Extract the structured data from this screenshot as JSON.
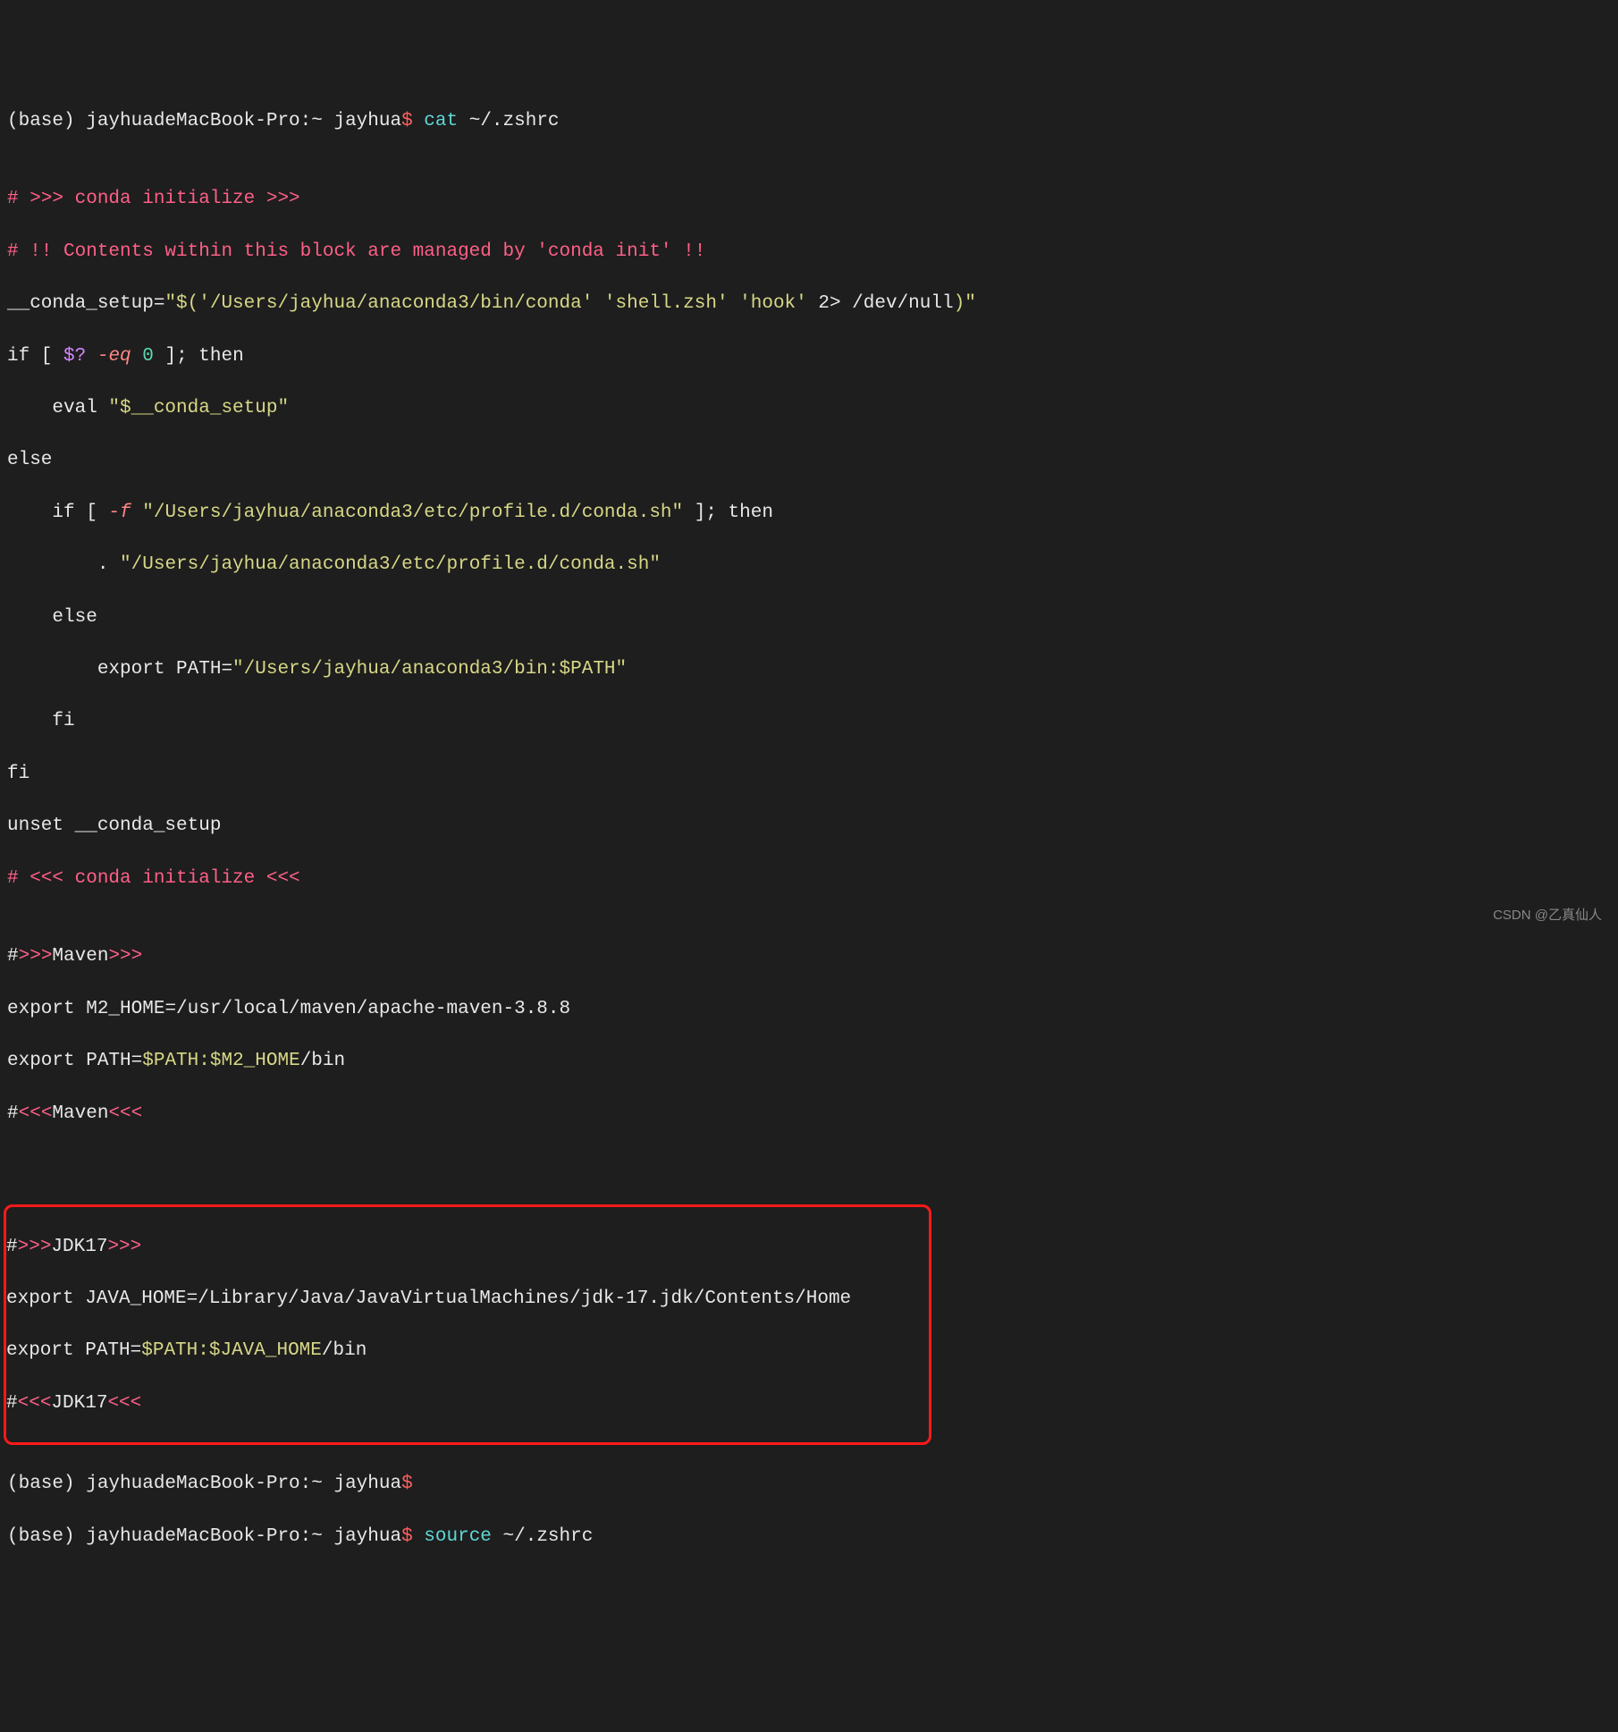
{
  "prompt1": {
    "env": "(base) ",
    "host": "jayhuadeMacBook-Pro:~ jayhua",
    "dollar": "$ ",
    "cmd": "cat ",
    "arg": "~/.zshrc"
  },
  "blank1": "",
  "l_comment1": "# >>> conda initialize >>>",
  "l_comment2": "# !! Contents within this block are managed by 'conda init' !!",
  "l_setup": {
    "a": "__conda_setup=",
    "b": "\"$(",
    "c": "'/Users/jayhua/anaconda3/bin/conda' 'shell.zsh' 'hook'",
    "d": " 2> /dev/null",
    "e": ")\""
  },
  "l_if1": {
    "a": "if [ ",
    "b": "$?",
    "c": " -eq ",
    "d": "0",
    "e": " ]; then"
  },
  "l_eval": {
    "a": "    eval ",
    "b": "\"$__conda_setup\""
  },
  "l_else1": "else",
  "l_if2": {
    "a": "    if [ ",
    "b": "-f ",
    "c": "\"/Users/jayhua/anaconda3/etc/profile.d/conda.sh\"",
    "d": " ]; then"
  },
  "l_source": {
    "a": "        . ",
    "b": "\"/Users/jayhua/anaconda3/etc/profile.d/conda.sh\""
  },
  "l_else2": "    else",
  "l_export1": {
    "a": "        export PATH=",
    "b": "\"/Users/jayhua/anaconda3/bin:$PATH\""
  },
  "l_fi1": "    fi",
  "l_fi2": "fi",
  "l_unset": "unset __conda_setup",
  "l_comment3": "# <<< conda initialize <<<",
  "blank2": "",
  "l_mvn1": {
    "a": "#",
    "b": ">>>",
    "c": "Maven",
    ">": ">>>"
  },
  "l_mvn2": {
    "a": "export M2_HOME",
    "b": "=/usr/local/maven/apache-maven-3.8.8"
  },
  "l_mvn3": {
    "a": "export PATH",
    "b": "=",
    "c": "$PATH",
    "d": ":",
    "e": "$M2_HOME",
    "f": "/bin"
  },
  "l_mvn4": {
    "a": "#",
    "b": "<<<",
    "c": "Maven",
    "<": "<<<"
  },
  "blank3": "",
  "blank4": "",
  "l_jdk1": {
    "a": "#",
    "b": ">>>",
    "c": "JDK17",
    ">": ">>>"
  },
  "l_jdk2": {
    "a": "export JAVA_HOME",
    "b": "=/Library/Java/JavaVirtualMachines/jdk-17.jdk/Contents/Home"
  },
  "l_jdk3": {
    "a": "export PATH",
    "b": "=",
    "c": "$PATH",
    "d": ":",
    "e": "$JAVA_HOME",
    "f": "/bin"
  },
  "l_jdk4": {
    "a": "#",
    "b": "<<<",
    "c": "JDK17",
    "<": "<<<"
  },
  "prompt2": {
    "env": "(base) ",
    "host": "jayhuadeMacBook-Pro:~ jayhua",
    "dollar": "$"
  },
  "prompt3": {
    "env": "(base) ",
    "host": "jayhuadeMacBook-Pro:~ jayhua",
    "dollar": "$ ",
    "cmd": "source ",
    "arg": "~/.zshrc"
  },
  "watermark": "CSDN @乙真仙人"
}
